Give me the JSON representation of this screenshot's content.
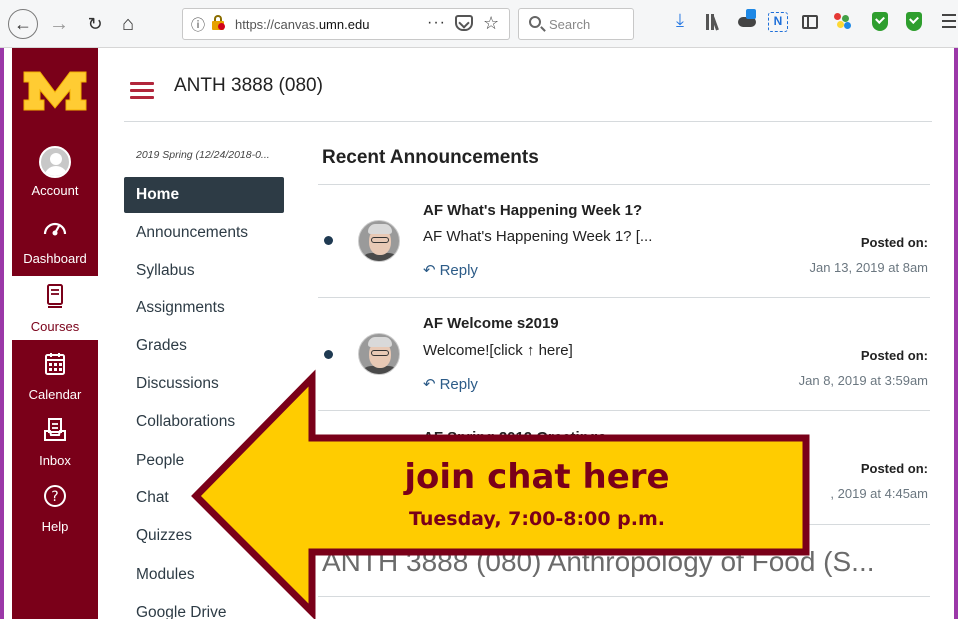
{
  "browser": {
    "url_prefix": "https://canvas.",
    "url_domain": "umn.edu",
    "url_menu": "···",
    "search_placeholder": "Search",
    "n_badge": "N"
  },
  "global_nav": {
    "items": [
      {
        "label": "Account",
        "icon": "account-avatar-icon"
      },
      {
        "label": "Dashboard",
        "icon": "dashboard-gauge-icon"
      },
      {
        "label": "Courses",
        "icon": "courses-book-icon",
        "active": true
      },
      {
        "label": "Calendar",
        "icon": "calendar-icon"
      },
      {
        "label": "Inbox",
        "icon": "inbox-icon"
      },
      {
        "label": "Help",
        "icon": "help-icon"
      }
    ],
    "brand_color": "#7a0019",
    "logo_gold": "#ffcc33"
  },
  "course": {
    "title": "ANTH 3888 (080)",
    "term": "2019 Spring (12/24/2018-0..."
  },
  "course_nav": {
    "items": [
      {
        "label": "Home",
        "active": true
      },
      {
        "label": "Announcements"
      },
      {
        "label": "Syllabus"
      },
      {
        "label": "Assignments"
      },
      {
        "label": "Grades"
      },
      {
        "label": "Discussions"
      },
      {
        "label": "Collaborations"
      },
      {
        "label": "People"
      },
      {
        "label": "Chat"
      },
      {
        "label": "Quizzes"
      },
      {
        "label": "Modules"
      },
      {
        "label": "Google Drive"
      }
    ]
  },
  "announcements": {
    "section_title": "Recent Announcements",
    "reply_label": "Reply",
    "posted_label": "Posted on:",
    "items": [
      {
        "title": "AF What's Happening Week 1?",
        "snippet": "AF What's Happening Week 1? [...",
        "date": "Jan 13, 2019 at 8am"
      },
      {
        "title": "AF Welcome s2019",
        "snippet": "Welcome![click ↑ here]",
        "date": "Jan 8, 2019 at 3:59am"
      },
      {
        "title": "AF Spring 2019 Greetings",
        "snippet": "",
        "date": ", 2019 at 4:45am"
      }
    ]
  },
  "page_heading": "ANTH 3888 (080) Anthropology of Food (S...",
  "callout": {
    "line1": "join chat here",
    "line2": "Tuesday, 7:00-8:00 p.m.",
    "fill_color": "#ffcc00",
    "border_color": "#7a0019"
  }
}
